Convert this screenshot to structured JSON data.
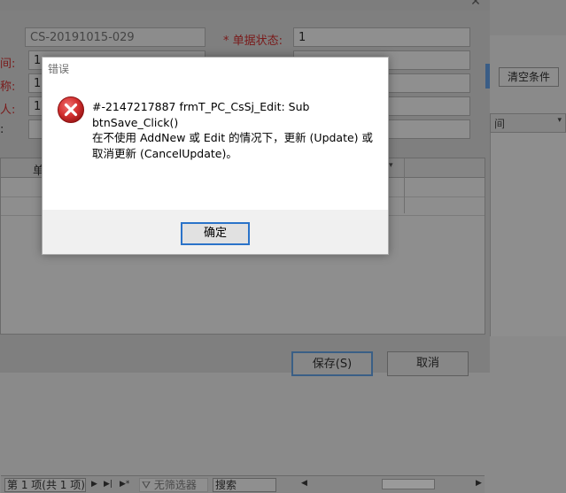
{
  "form": {
    "doc_no": "CS-20191015-029",
    "status_label": "* 单据状态:",
    "status_value": "1",
    "label_time": "间:",
    "label_name": "称:",
    "label_amount": "人:",
    "label_memo": ":",
    "value_1": "1",
    "value_2": "1",
    "value_3": "12",
    "grid_header_partial": "单",
    "nav_record": "第 1 项(共 1 项)",
    "nav_filter": "无筛选器",
    "nav_search": "搜索",
    "save_button": "保存(S)",
    "cancel_button": "取消"
  },
  "right_panel": {
    "clear_button": "清空条件",
    "col_header": "间"
  },
  "dialog": {
    "title": "错误",
    "message": "#-2147217887 frmT_PC_CsSj_Edit: Sub\nbtnSave_Click()\n在不使用 AddNew 或 Edit 的情况下，更新 (Update) 或\n取消更新 (CancelUpdate)。",
    "ok_button": "确定",
    "icon": "error-icon"
  },
  "colors": {
    "error_red": "#c42b2b",
    "focus_blue": "#2a73c9"
  }
}
